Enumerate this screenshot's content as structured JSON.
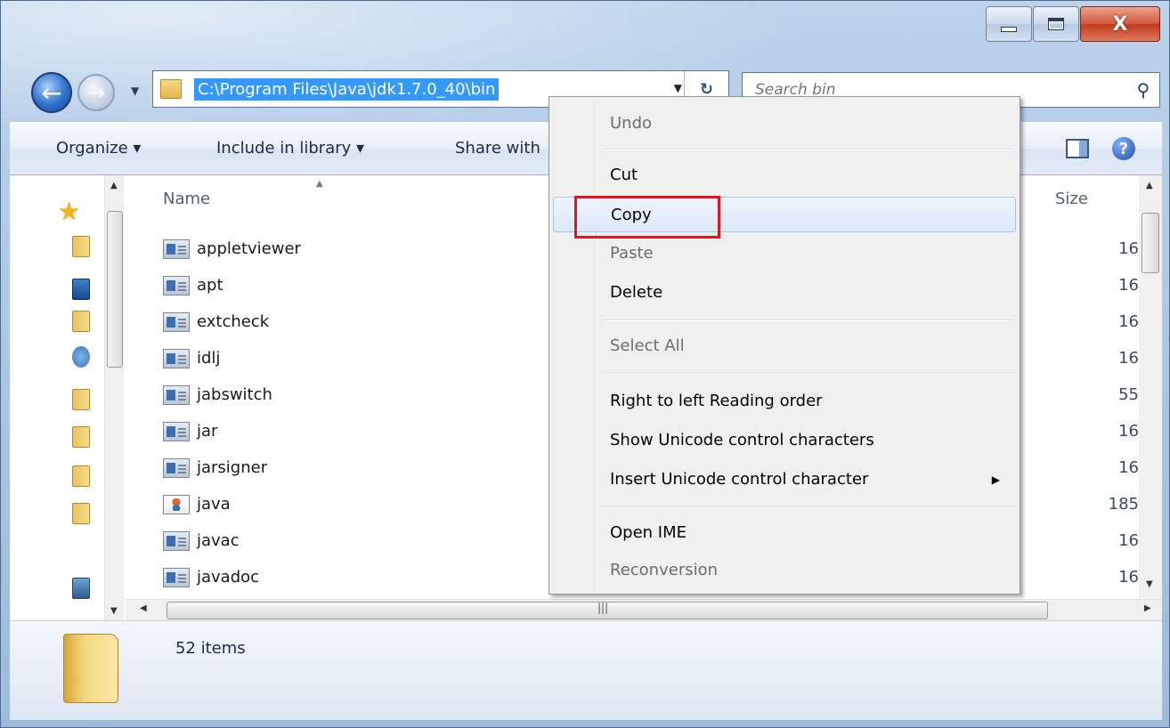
{
  "window": {
    "caption": {
      "minimize": "",
      "maximize": "",
      "close": "X"
    }
  },
  "nav": {
    "address_path": "C:\\Program Files\\Java\\jdk1.7.0_40\\bin",
    "search_placeholder": "Search bin",
    "refresh_glyph": "↻"
  },
  "commandbar": {
    "organize": "Organize ▾",
    "include_in_library": "Include in library ▾",
    "share_with": "Share with"
  },
  "columns": {
    "name": "Name",
    "size": "Size"
  },
  "files": [
    {
      "name": "appletviewer",
      "size": "16",
      "type": "app"
    },
    {
      "name": "apt",
      "size": "16",
      "type": "app"
    },
    {
      "name": "extcheck",
      "size": "16",
      "type": "app"
    },
    {
      "name": "idlj",
      "size": "16",
      "type": "app"
    },
    {
      "name": "jabswitch",
      "size": "55",
      "type": "app"
    },
    {
      "name": "jar",
      "size": "16",
      "type": "app"
    },
    {
      "name": "jarsigner",
      "size": "16",
      "type": "app"
    },
    {
      "name": "java",
      "size": "185",
      "type": "java"
    },
    {
      "name": "javac",
      "size": "16",
      "type": "app"
    },
    {
      "name": "javadoc",
      "size": "16",
      "type": "app"
    }
  ],
  "status": {
    "item_count": "52 items"
  },
  "context_menu": {
    "undo": "Undo",
    "cut": "Cut",
    "copy": "Copy",
    "paste": "Paste",
    "delete": "Delete",
    "select_all": "Select All",
    "rtl": "Right to left Reading order",
    "show_unicode": "Show Unicode control characters",
    "insert_unicode": "Insert Unicode control character",
    "open_ime": "Open IME",
    "reconversion": "Reconversion"
  },
  "colors": {
    "highlight": "#e3141b",
    "selection": "#3399ff"
  }
}
